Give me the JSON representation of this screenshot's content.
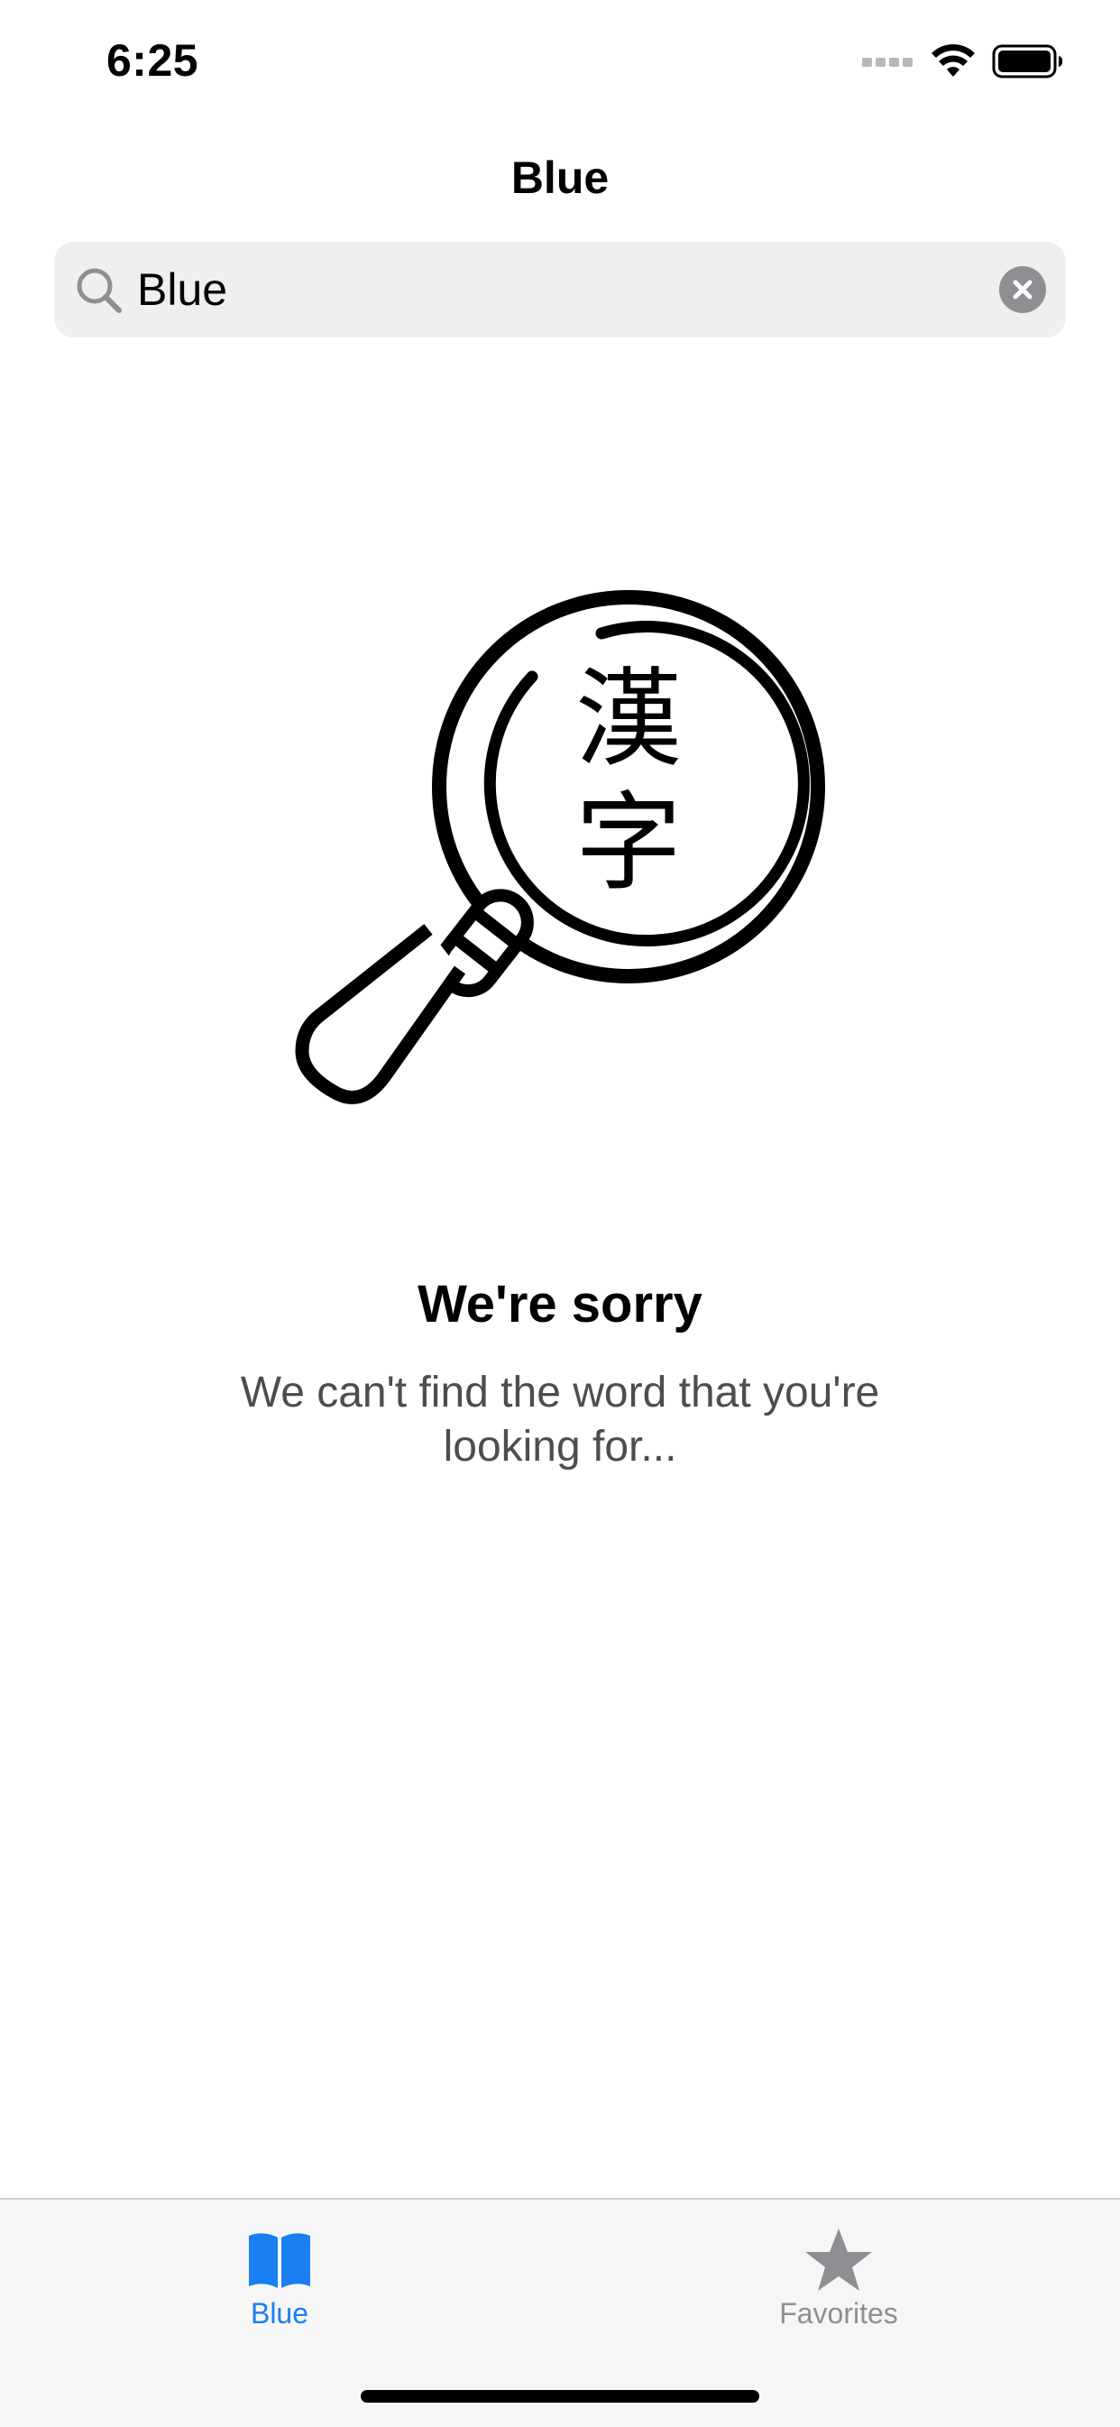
{
  "status_bar": {
    "time": "6:25",
    "icons": [
      "signal-icon",
      "wifi-icon",
      "battery-icon"
    ]
  },
  "nav": {
    "title": "Blue"
  },
  "search": {
    "value": "Blue",
    "icon": "search-icon",
    "clear_icon": "clear-icon"
  },
  "empty_state": {
    "illustration": "magnifier-kanji-icon",
    "kanji": [
      "漢",
      "字"
    ],
    "title": "We're sorry",
    "message": "We can't find the word that you're looking for..."
  },
  "tab_bar": {
    "tabs": [
      {
        "label": "Blue",
        "icon": "book-icon",
        "selected": true
      },
      {
        "label": "Favorites",
        "icon": "star-icon",
        "selected": false
      }
    ],
    "active_color": "#1a7ff0",
    "inactive_color": "#8e8e93"
  }
}
